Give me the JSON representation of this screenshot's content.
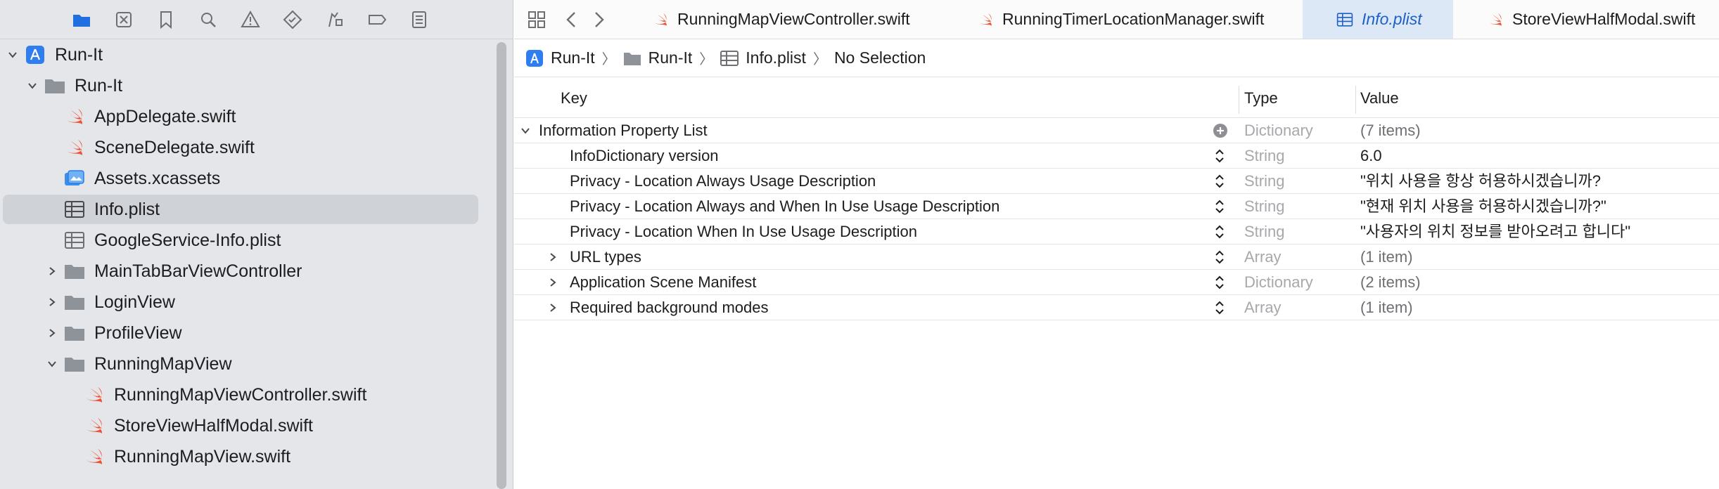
{
  "navigator": {
    "icons": [
      "folder-icon",
      "source-control-icon",
      "bookmark-icon",
      "find-icon",
      "issue-icon",
      "test-icon",
      "debug-icon",
      "breakpoint-icon",
      "report-icon"
    ]
  },
  "tree": [
    {
      "label": "Run-It",
      "kind": "project",
      "expanded": true
    },
    {
      "label": "Run-It",
      "kind": "folder",
      "expanded": true
    },
    {
      "label": "AppDelegate.swift",
      "kind": "swift"
    },
    {
      "label": "SceneDelegate.swift",
      "kind": "swift"
    },
    {
      "label": "Assets.xcassets",
      "kind": "assets"
    },
    {
      "label": "Info.plist",
      "kind": "plist",
      "selected": true
    },
    {
      "label": "GoogleService-Info.plist",
      "kind": "plist"
    },
    {
      "label": "MainTabBarViewController",
      "kind": "folder",
      "expanded": false
    },
    {
      "label": "LoginView",
      "kind": "folder",
      "expanded": false
    },
    {
      "label": "ProfileView",
      "kind": "folder",
      "expanded": false
    },
    {
      "label": "RunningMapView",
      "kind": "folder",
      "expanded": true
    },
    {
      "label": "RunningMapViewController.swift",
      "kind": "swift"
    },
    {
      "label": "StoreViewHalfModal.swift",
      "kind": "swift"
    },
    {
      "label": "RunningMapView.swift",
      "kind": "swift"
    }
  ],
  "tabs": [
    {
      "label": "RunningMapViewController.swift",
      "kind": "swift",
      "active": false
    },
    {
      "label": "RunningTimerLocationManager.swift",
      "kind": "swift",
      "active": false
    },
    {
      "label": "Info.plist",
      "kind": "plist",
      "active": true
    },
    {
      "label": "StoreViewHalfModal.swift",
      "kind": "swift",
      "active": false
    }
  ],
  "breadcrumb": {
    "project": "Run-It",
    "folder": "Run-It",
    "file": "Info.plist",
    "selection": "No Selection"
  },
  "plist": {
    "headers": {
      "key": "Key",
      "type": "Type",
      "value": "Value"
    },
    "rows": [
      {
        "key": "Information Property List",
        "type": "Dictionary",
        "value": "(7 items)",
        "level": 0,
        "disclosure": "open",
        "control": "add"
      },
      {
        "key": "InfoDictionary version",
        "type": "String",
        "value": "6.0",
        "level": 1,
        "disclosure": "none",
        "control": "stepper"
      },
      {
        "key": "Privacy - Location Always Usage Description",
        "type": "String",
        "value": "\"위치 사용을 항상 허용하시겠습니까?",
        "level": 1,
        "disclosure": "none",
        "control": "stepper"
      },
      {
        "key": "Privacy - Location Always and When In Use Usage Description",
        "type": "String",
        "value": "\"현재 위치 사용을 허용하시겠습니까?\"",
        "level": 1,
        "disclosure": "none",
        "control": "stepper"
      },
      {
        "key": "Privacy - Location When In Use Usage Description",
        "type": "String",
        "value": "\"사용자의 위치 정보를 받아오려고 합니다\"",
        "level": 1,
        "disclosure": "none",
        "control": "stepper"
      },
      {
        "key": "URL types",
        "type": "Array",
        "value": "(1 item)",
        "level": 1,
        "disclosure": "closed",
        "control": "stepper"
      },
      {
        "key": "Application Scene Manifest",
        "type": "Dictionary",
        "value": "(2 items)",
        "level": 1,
        "disclosure": "closed",
        "control": "stepper"
      },
      {
        "key": "Required background modes",
        "type": "Array",
        "value": "(1 item)",
        "level": 1,
        "disclosure": "closed",
        "control": "stepper"
      }
    ]
  },
  "colors": {
    "accent": "#1f6fe0",
    "swift": "#f05138",
    "folder": "#8e939a",
    "sidebar_bg": "#e4e6e9",
    "selection_bg": "#cfd2d6",
    "active_tab_bg": "#dde8f7"
  }
}
